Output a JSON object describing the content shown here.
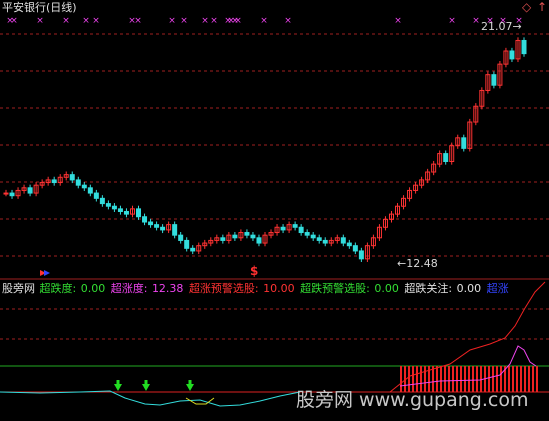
{
  "chart_title": "平安银行(日线)",
  "corner_icons": {
    "diamond": "◇",
    "arrow": "↑"
  },
  "price_labels": {
    "high": "21.07",
    "low": "12.48",
    "high_arrow": "→",
    "low_arrow": "←"
  },
  "signal_marker": "$",
  "indicator_row": {
    "name": "股旁网",
    "items": [
      {
        "label": "超跌度:",
        "value": "0.00",
        "color": "#33dd33"
      },
      {
        "label": "超涨度:",
        "value": "12.38",
        "color": "#ee44ee"
      },
      {
        "label": "超涨预警选股:",
        "value": "10.00",
        "color": "#ff3333"
      },
      {
        "label": "超跌预警选股:",
        "value": "0.00",
        "color": "#33dd33"
      },
      {
        "label": "超跌关注:",
        "value": "0.00",
        "color": "#e0e0e0"
      }
    ],
    "tail_label": "超涨",
    "tail_color": "#3344ff"
  },
  "watermark": "股旁网 www.gupang.com",
  "colors": {
    "up_candle": "#ff3333",
    "down_candle": "#33dddd",
    "grid": "#a02020",
    "marker_x": "#ee44ee",
    "down_arrow": "#22dd22"
  },
  "chart_data": {
    "type": "candlestick",
    "symbol": "平安银行",
    "period": "日线",
    "extremes": {
      "high": 21.07,
      "low": 12.48
    },
    "price_series": [
      15.1,
      15.0,
      15.2,
      15.3,
      15.1,
      15.4,
      15.5,
      15.6,
      15.5,
      15.7,
      15.8,
      15.6,
      15.4,
      15.3,
      15.1,
      14.9,
      14.7,
      14.6,
      14.5,
      14.4,
      14.3,
      14.5,
      14.2,
      14.0,
      13.9,
      13.8,
      13.7,
      13.9,
      13.5,
      13.3,
      13.0,
      12.9,
      13.1,
      13.2,
      13.3,
      13.4,
      13.3,
      13.5,
      13.4,
      13.6,
      13.5,
      13.4,
      13.2,
      13.5,
      13.6,
      13.8,
      13.7,
      13.9,
      13.8,
      13.6,
      13.5,
      13.4,
      13.3,
      13.2,
      13.3,
      13.4,
      13.2,
      13.1,
      12.9,
      12.6,
      13.1,
      13.4,
      13.8,
      14.1,
      14.3,
      14.6,
      14.9,
      15.2,
      15.4,
      15.6,
      15.9,
      16.2,
      16.6,
      16.3,
      16.9,
      17.2,
      16.8,
      17.8,
      18.4,
      19.0,
      19.6,
      19.2,
      20.0,
      20.5,
      20.2,
      20.9,
      20.4
    ]
  }
}
